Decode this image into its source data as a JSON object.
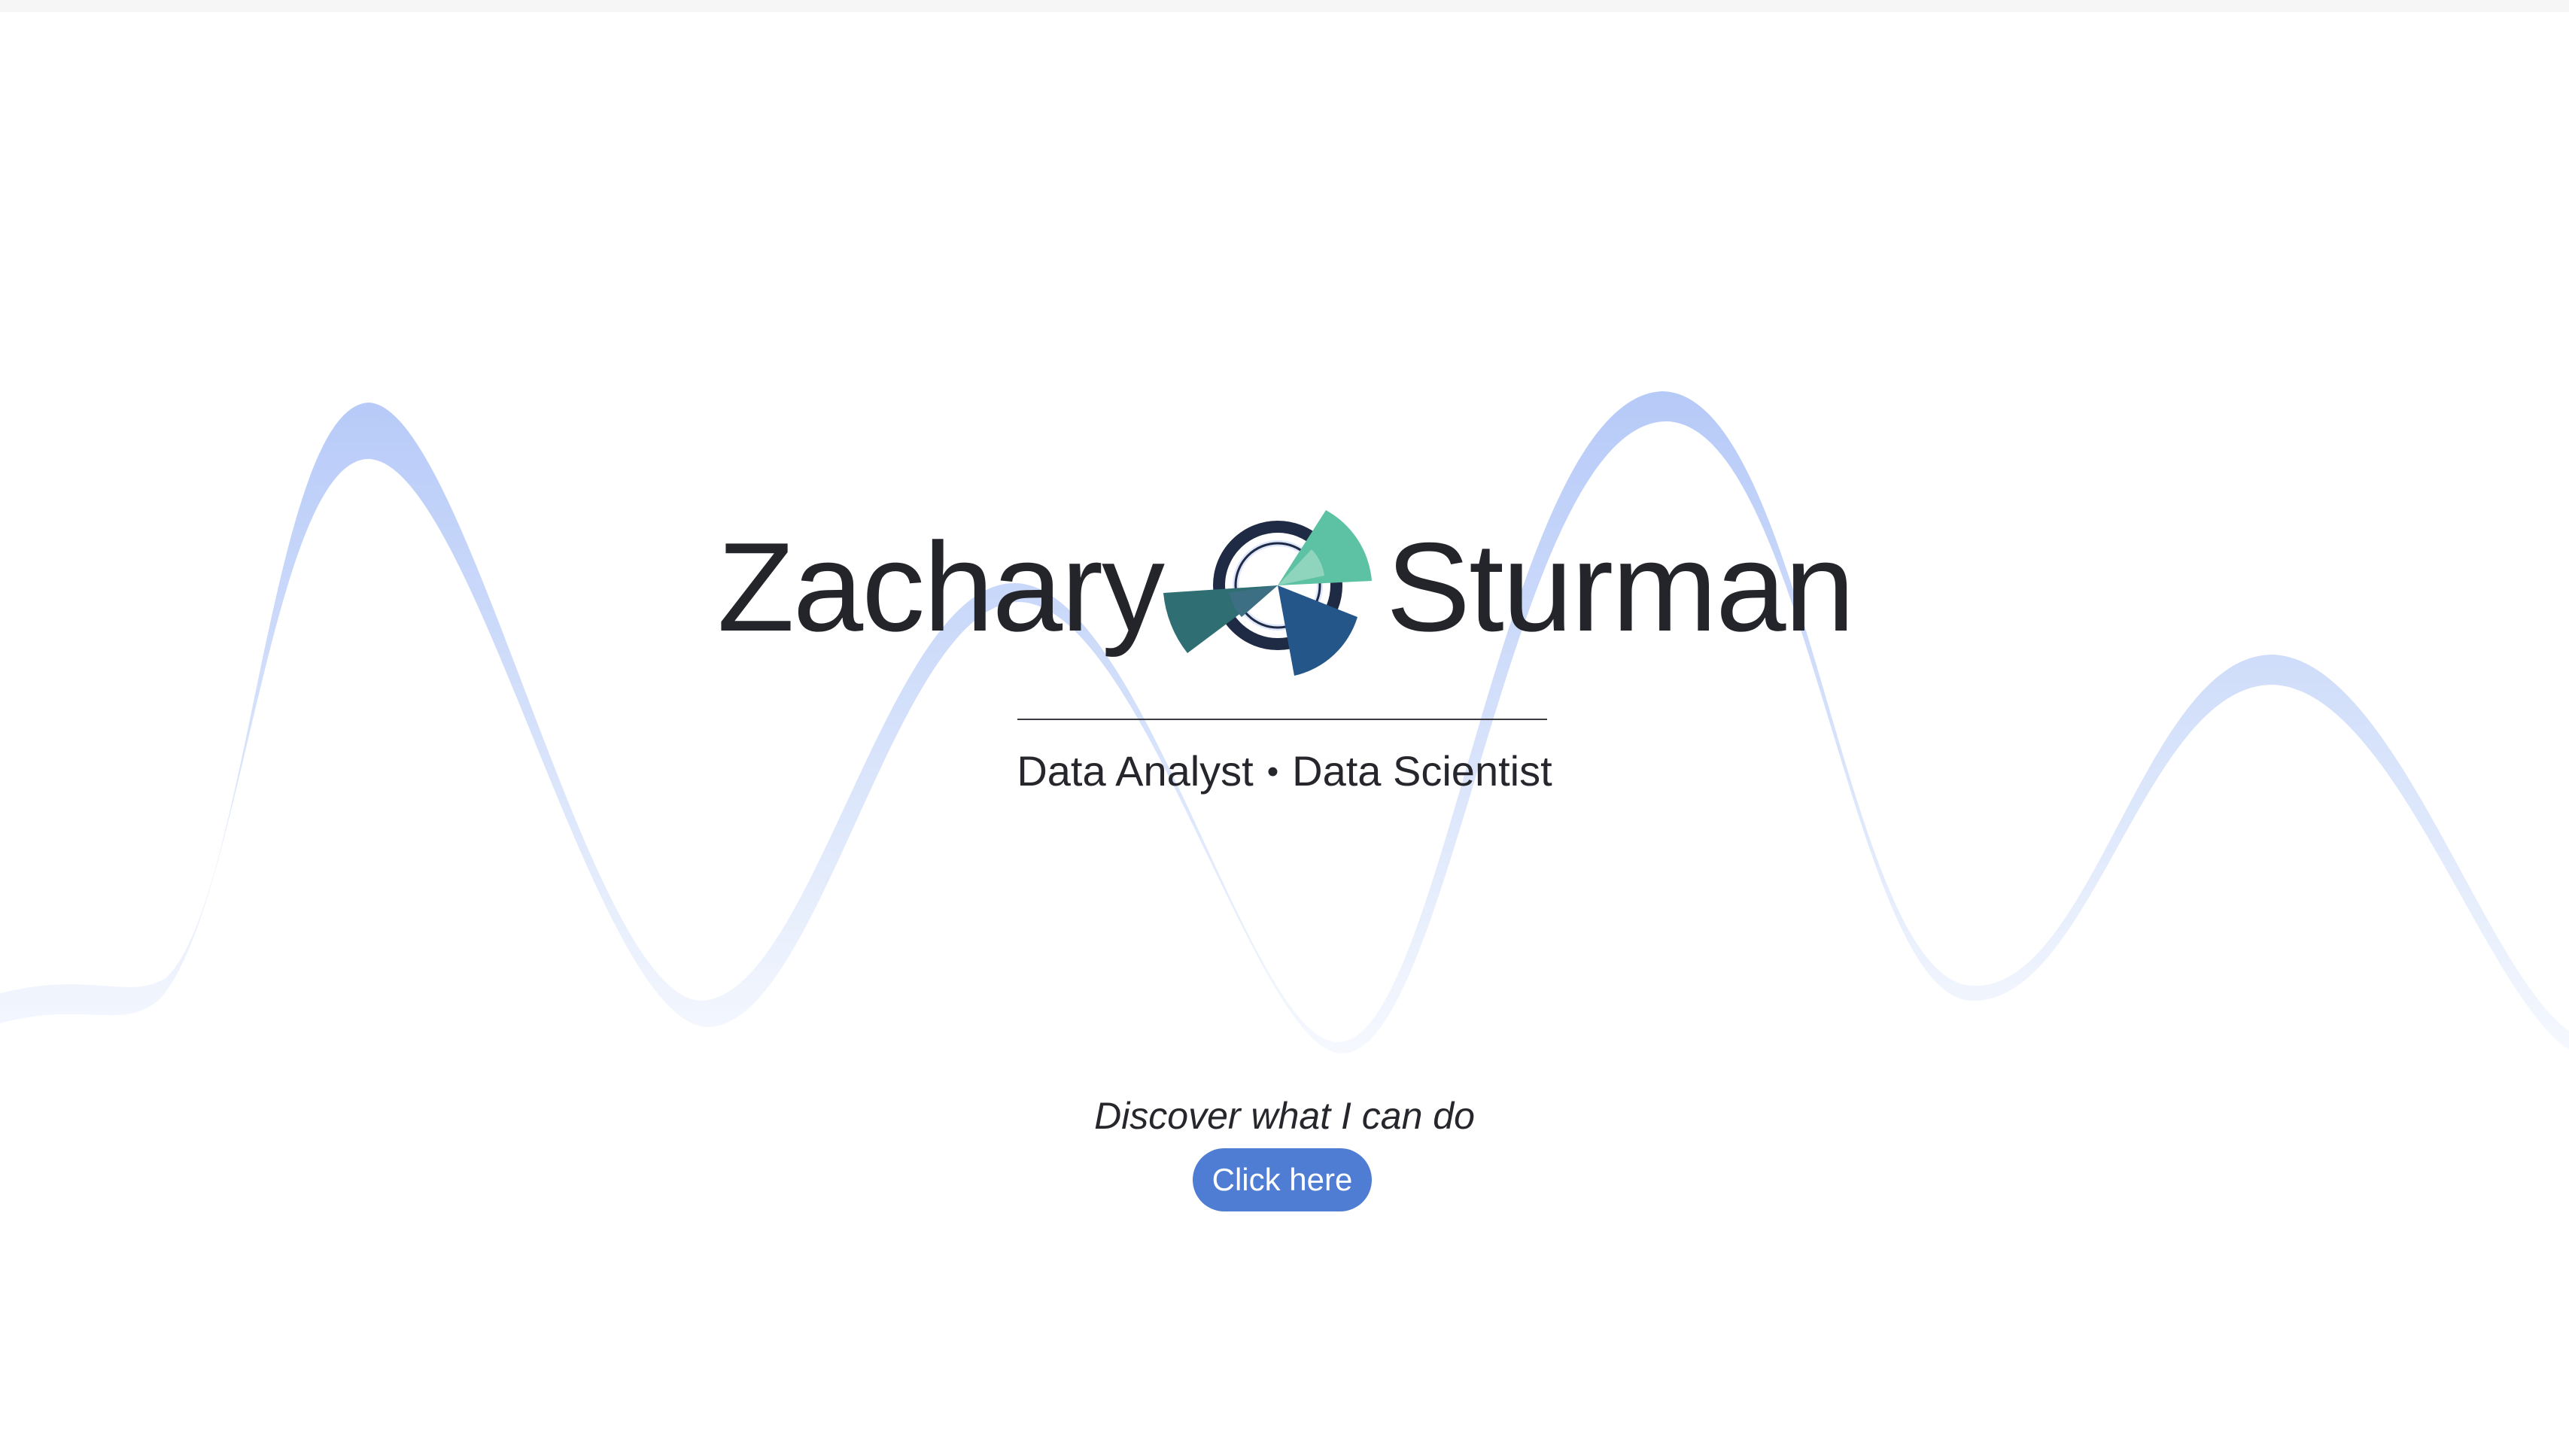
{
  "hero": {
    "first_name": "Zachary",
    "last_name": "Sturman",
    "role_1": "Data Analyst",
    "separator": "•",
    "role_2": "Data Scientist",
    "cta_text": "Discover what I can do",
    "cta_button_label": "Click here"
  },
  "colors": {
    "wave_top": "#7aa0f5",
    "wave_bottom": "#ffffff",
    "button": "#4f7dd3",
    "logo_ring": "#1f2a44",
    "logo_teal": "#2f6f73",
    "logo_mint": "#5cc2a3",
    "logo_navy": "#24568a"
  },
  "icons": {
    "logo": "radial-chart-logo-icon"
  }
}
